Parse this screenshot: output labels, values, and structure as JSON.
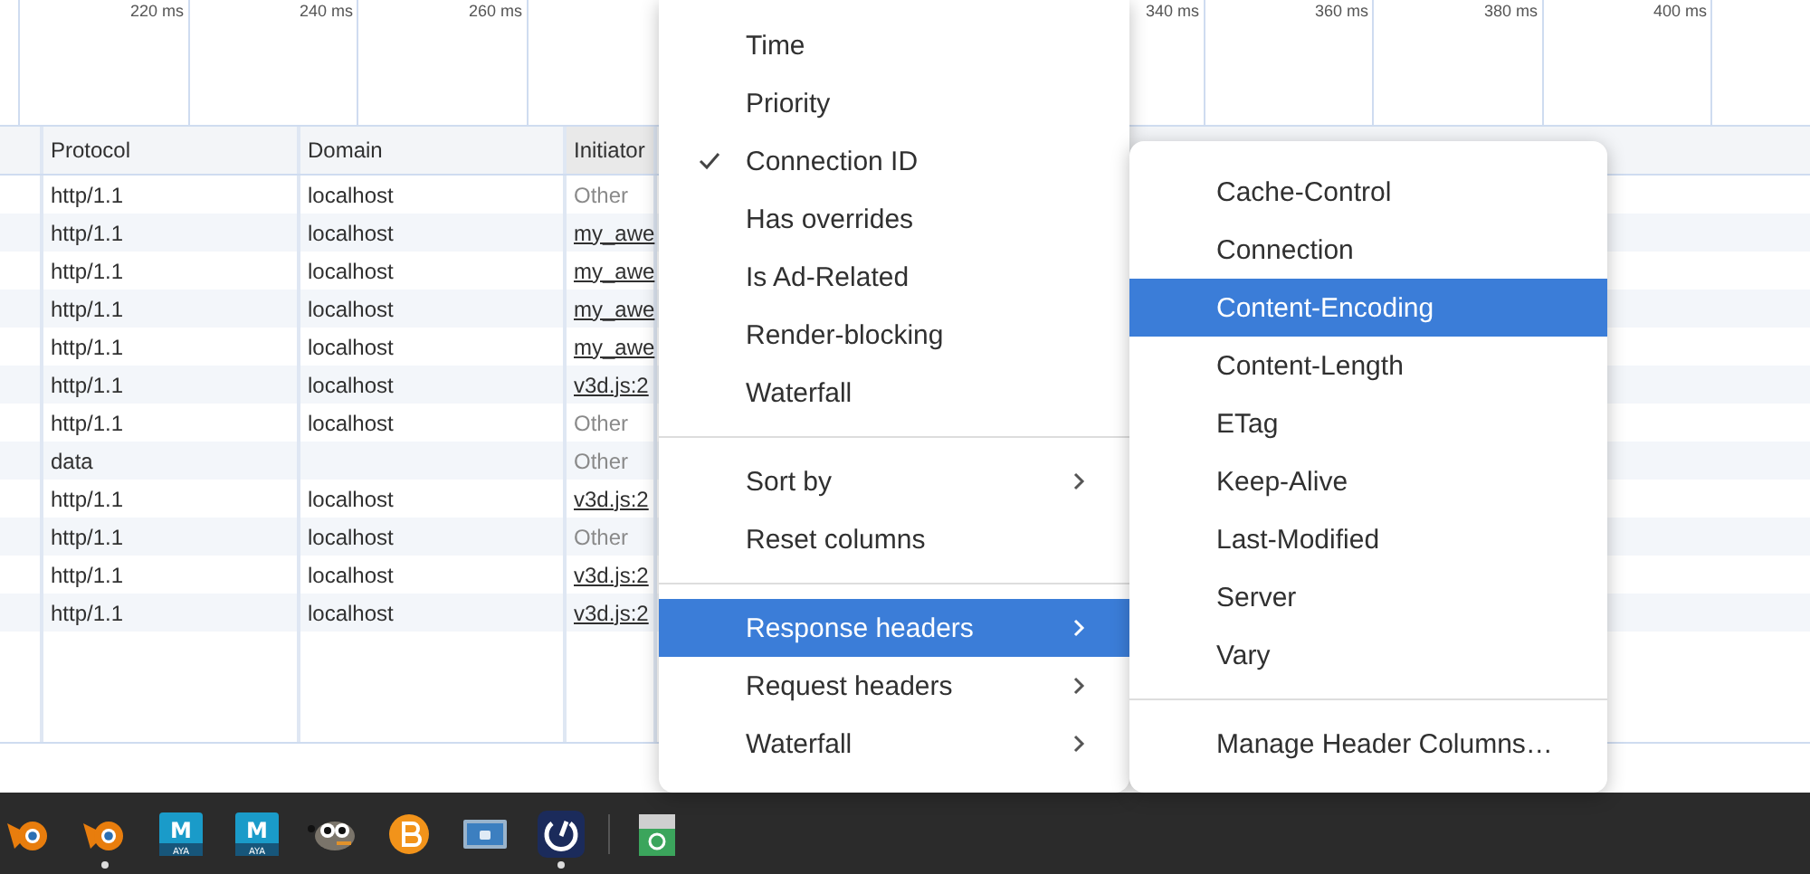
{
  "timeline": {
    "left_ticks": [
      "220 ms",
      "240 ms",
      "260 ms"
    ],
    "right_ticks": [
      "340 ms",
      "360 ms",
      "380 ms",
      "400 ms"
    ]
  },
  "table": {
    "columns": [
      "Protocol",
      "Domain",
      "Initiator"
    ],
    "rows": [
      {
        "protocol": "http/1.1",
        "domain": "localhost",
        "initiator": "Other",
        "link": false
      },
      {
        "protocol": "http/1.1",
        "domain": "localhost",
        "initiator": "my_awe",
        "link": true
      },
      {
        "protocol": "http/1.1",
        "domain": "localhost",
        "initiator": "my_awe",
        "link": true
      },
      {
        "protocol": "http/1.1",
        "domain": "localhost",
        "initiator": "my_awe",
        "link": true
      },
      {
        "protocol": "http/1.1",
        "domain": "localhost",
        "initiator": "my_awe",
        "link": true
      },
      {
        "protocol": "http/1.1",
        "domain": "localhost",
        "initiator": "v3d.js:2",
        "link": true
      },
      {
        "protocol": "http/1.1",
        "domain": "localhost",
        "initiator": "Other",
        "link": false
      },
      {
        "protocol": "data",
        "initiator": "Other",
        "link": false
      },
      {
        "protocol": "http/1.1",
        "domain": "localhost",
        "initiator": "v3d.js:2",
        "link": true
      },
      {
        "protocol": "http/1.1",
        "domain": "localhost",
        "initiator": "Other",
        "link": false
      },
      {
        "protocol": "http/1.1",
        "domain": "localhost",
        "initiator": "v3d.js:2",
        "link": true
      },
      {
        "protocol": "http/1.1",
        "domain": "localhost",
        "initiator": "v3d.js:2",
        "link": true
      }
    ]
  },
  "context_menu": {
    "items": [
      {
        "kind": "check",
        "label": "Time",
        "checked": false
      },
      {
        "kind": "check",
        "label": "Priority",
        "checked": false
      },
      {
        "kind": "check",
        "label": "Connection ID",
        "checked": true
      },
      {
        "kind": "check",
        "label": "Has overrides",
        "checked": false
      },
      {
        "kind": "check",
        "label": "Is Ad-Related",
        "checked": false
      },
      {
        "kind": "check",
        "label": "Render-blocking",
        "checked": false
      },
      {
        "kind": "check",
        "label": "Waterfall",
        "checked": false
      },
      {
        "kind": "separator"
      },
      {
        "kind": "submenu",
        "label": "Sort by",
        "selected": false
      },
      {
        "kind": "action",
        "label": "Reset columns"
      },
      {
        "kind": "separator"
      },
      {
        "kind": "submenu",
        "label": "Response headers",
        "selected": true
      },
      {
        "kind": "submenu",
        "label": "Request headers",
        "selected": false
      },
      {
        "kind": "submenu",
        "label": "Waterfall",
        "selected": false
      }
    ]
  },
  "submenu": {
    "items": [
      {
        "kind": "item",
        "label": "Cache-Control",
        "selected": false
      },
      {
        "kind": "item",
        "label": "Connection",
        "selected": false
      },
      {
        "kind": "item",
        "label": "Content-Encoding",
        "selected": true
      },
      {
        "kind": "item",
        "label": "Content-Length",
        "selected": false
      },
      {
        "kind": "item",
        "label": "ETag",
        "selected": false
      },
      {
        "kind": "item",
        "label": "Keep-Alive",
        "selected": false
      },
      {
        "kind": "item",
        "label": "Last-Modified",
        "selected": false
      },
      {
        "kind": "item",
        "label": "Server",
        "selected": false
      },
      {
        "kind": "item",
        "label": "Vary",
        "selected": false
      },
      {
        "kind": "separator"
      },
      {
        "kind": "item",
        "label": "Manage Header Columns…",
        "selected": false
      }
    ]
  },
  "taskbar": {
    "apps": [
      {
        "kind": "ring",
        "running": false
      },
      {
        "kind": "ring",
        "running": true
      },
      {
        "kind": "maya",
        "letter": "M",
        "caption": "AYA",
        "running": false
      },
      {
        "kind": "maya",
        "letter": "M",
        "caption": "AYA",
        "running": false
      },
      {
        "kind": "mascot",
        "running": false
      },
      {
        "kind": "coin",
        "running": false
      },
      {
        "kind": "screen",
        "running": false
      },
      {
        "kind": "gauge",
        "running": true
      },
      {
        "kind": "divider"
      },
      {
        "kind": "trash",
        "running": false
      }
    ]
  }
}
